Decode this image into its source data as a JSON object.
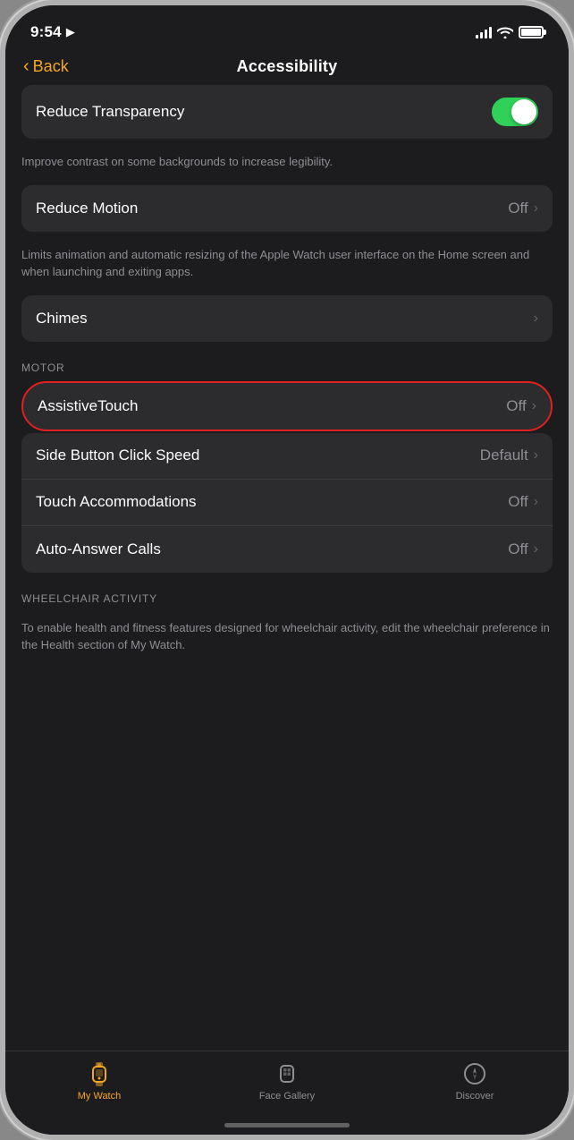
{
  "statusBar": {
    "time": "9:54",
    "locationIcon": "▶"
  },
  "navBar": {
    "backLabel": "Back",
    "title": "Accessibility"
  },
  "settings": {
    "reduceTransparency": {
      "label": "Reduce Transparency",
      "toggleState": "on",
      "description": "Improve contrast on some backgrounds to increase legibility."
    },
    "reduceMotion": {
      "label": "Reduce Motion",
      "value": "Off",
      "description": "Limits animation and automatic resizing of the Apple Watch user interface on the Home screen and when launching and exiting apps."
    },
    "chimes": {
      "label": "Chimes"
    },
    "motorSection": "MOTOR",
    "assistiveTouch": {
      "label": "AssistiveTouch",
      "value": "Off"
    },
    "sideButtonClickSpeed": {
      "label": "Side Button Click Speed",
      "value": "Default"
    },
    "touchAccommodations": {
      "label": "Touch Accommodations",
      "value": "Off"
    },
    "autoAnswerCalls": {
      "label": "Auto-Answer Calls",
      "value": "Off"
    },
    "wheelchairSection": "WHEELCHAIR ACTIVITY",
    "wheelchairDescription": "To enable health and fitness features designed for wheelchair activity, edit the wheelchair preference in the Health section of My Watch."
  },
  "tabBar": {
    "myWatch": {
      "label": "My Watch",
      "active": true
    },
    "faceGallery": {
      "label": "Face Gallery",
      "active": false
    },
    "discover": {
      "label": "Discover",
      "active": false
    }
  }
}
